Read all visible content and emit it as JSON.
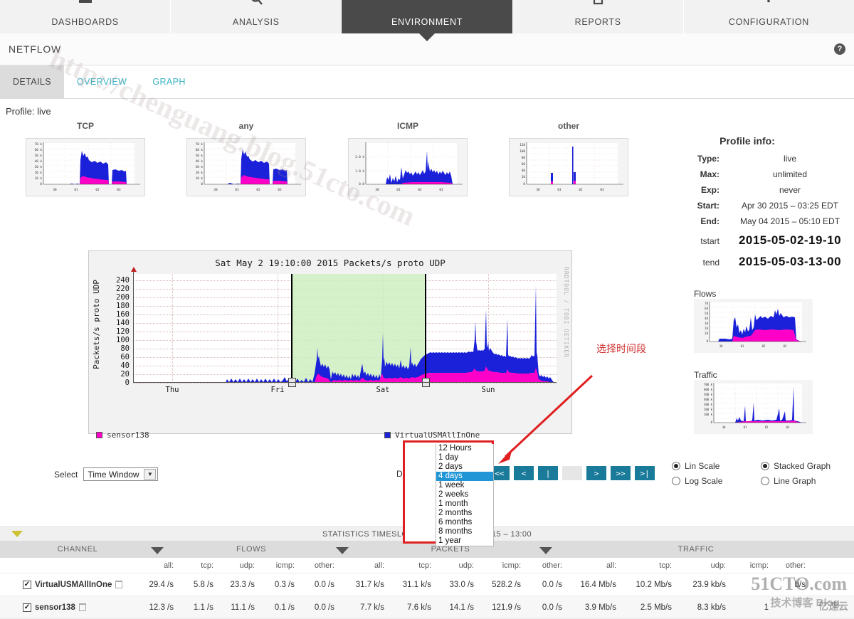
{
  "topnav": {
    "items": [
      {
        "label": "DASHBOARDS",
        "icon": "dashboard-grid-icon",
        "active": false
      },
      {
        "label": "ANALYSIS",
        "icon": "magnifier-icon",
        "active": false
      },
      {
        "label": "ENVIRONMENT",
        "icon": "network-icon",
        "active": true
      },
      {
        "label": "REPORTS",
        "icon": "document-icon",
        "active": false
      },
      {
        "label": "CONFIGURATION",
        "icon": "wrench-icon",
        "active": false
      }
    ]
  },
  "titlebar": {
    "title": "NETFLOW",
    "help_icon": "help-circle-icon"
  },
  "subtabs": [
    {
      "label": "DETAILS",
      "active": true
    },
    {
      "label": "OVERVIEW",
      "active": false
    },
    {
      "label": "GRAPH",
      "active": false
    }
  ],
  "profile_line": "Profile: live",
  "mini_graphs": [
    {
      "title": "TCP",
      "yticks": [
        "70 k",
        "60 k",
        "50 k",
        "40 k",
        "30 k",
        "20 k",
        "10 k",
        "0"
      ],
      "xticks": [
        "30",
        "01",
        "02",
        "03"
      ]
    },
    {
      "title": "any",
      "yticks": [
        "70 k",
        "60 k",
        "50 k",
        "40 k",
        "30 k",
        "20 k",
        "10 k",
        "0"
      ],
      "xticks": [
        "30",
        "01",
        "02",
        "03"
      ]
    },
    {
      "title": "ICMP",
      "yticks": [
        "2.0 k",
        "1.0 k",
        "0.0"
      ],
      "xticks": [
        "30",
        "01",
        "02",
        "03"
      ]
    },
    {
      "title": "other",
      "yticks": [
        "120",
        "100",
        "80",
        "60",
        "40",
        "20",
        "0"
      ],
      "xticks": [
        "30",
        "01",
        "02",
        "03"
      ]
    }
  ],
  "side_graphs": [
    {
      "title": "Flows",
      "yticks": [
        "70",
        "60",
        "50",
        "40",
        "30",
        "20",
        "10",
        "0"
      ],
      "xticks": [
        "30",
        "01",
        "02",
        "03"
      ]
    },
    {
      "title": "Traffic",
      "yticks": [
        "700 k",
        "600 k",
        "500 k",
        "400 k",
        "300 k",
        "200 k",
        "100 k",
        "0"
      ],
      "xticks": [
        "30",
        "01",
        "02",
        "03"
      ]
    }
  ],
  "chart_data": {
    "type": "area",
    "title": "Sat May  2 19:10:00 2015 Packets/s proto UDP",
    "ylabel": "Packets/s proto UDP",
    "xlabel": "",
    "credit": "RRDTOOL / TOBI OETIKER",
    "ylim": [
      0,
      250
    ],
    "yticks": [
      0,
      20,
      40,
      60,
      80,
      100,
      120,
      140,
      160,
      180,
      200,
      220,
      240
    ],
    "xticks": [
      "Thu",
      "Fri",
      "Sat",
      "Sun"
    ],
    "grid": true,
    "legend_position": "bottom",
    "series": [
      {
        "name": "sensor138",
        "color": "#ff00c8"
      },
      {
        "name": "VirtualUSMAllInOne",
        "color": "#1a21d8"
      }
    ],
    "selection": {
      "start_label": "Sat",
      "end_label": "Sun",
      "highlight_color": "#cdeec0"
    }
  },
  "profile_info": {
    "heading": "Profile info:",
    "rows": [
      {
        "key": "Type:",
        "value": "live"
      },
      {
        "key": "Max:",
        "value": "unlimited"
      },
      {
        "key": "Exp:",
        "value": "never"
      },
      {
        "key": "Start:",
        "value": "Apr 30 2015 – 03:25 EDT"
      },
      {
        "key": "End:",
        "value": "May 04 2015 – 05:10 EDT"
      }
    ],
    "tstart_key": "tstart",
    "tstart_value": "2015-05-02-19-10",
    "tend_key": "tend",
    "tend_value": "2015-05-03-13-00"
  },
  "controls": {
    "select_label": "Select",
    "select_value": "Time Window",
    "select_caret": "chevron-down-icon",
    "display_label": "Display:",
    "nav_buttons": [
      {
        "label": "<<",
        "name": "nav-first-back",
        "disabled": false
      },
      {
        "label": "<",
        "name": "nav-back",
        "disabled": false
      },
      {
        "label": "|",
        "name": "nav-mark",
        "disabled": false
      },
      {
        "label": "",
        "name": "nav-disabled",
        "disabled": true
      },
      {
        "label": ">",
        "name": "nav-forward",
        "disabled": false
      },
      {
        "label": ">>",
        "name": "nav-fast-forward",
        "disabled": false
      },
      {
        "label": ">|",
        "name": "nav-last",
        "disabled": false
      }
    ],
    "scale_options": [
      {
        "label": "Lin Scale",
        "selected": true
      },
      {
        "label": "Stacked Graph",
        "selected": true
      },
      {
        "label": "Log Scale",
        "selected": false
      },
      {
        "label": "Line Graph",
        "selected": false
      }
    ]
  },
  "dropdown": {
    "options": [
      "12 Hours",
      "1 day",
      "2 days",
      "4 days",
      "1 week",
      "2 weeks",
      "1 month",
      "2 months",
      "6 months",
      "8 months",
      "1 year"
    ],
    "selected": "4 days",
    "highlight_color": "#2196d6",
    "frame_color": "#e02020"
  },
  "annotation": {
    "text": "选择时间段",
    "color": "#d03030",
    "arrow": "red-arrow-icon"
  },
  "stats": {
    "collapse_icon": "triangle-down-icon",
    "timeslot": "STATISTICS TIMESLOT MAY 02 20        AY 03 2015 – 13:00",
    "group_headers": [
      "CHANNEL",
      "FLOWS",
      "PACKETS",
      "TRAFFIC"
    ],
    "sort_icon": "sort-down-icon",
    "sub_headers": [
      "all:",
      "tcp:",
      "udp:",
      "icmp:",
      "other:",
      "all:",
      "tcp:",
      "udp:",
      "icmp:",
      "other:",
      "all:",
      "tcp:",
      "udp:",
      "icmp:",
      "other:"
    ],
    "rows": [
      {
        "checked": true,
        "name": "VirtualUSMAllInOne",
        "delete_icon": "trash-icon",
        "values": [
          "29.4 /s",
          "5.8 /s",
          "23.3 /s",
          "0.3 /s",
          "0.0 /s",
          "31.7 k/s",
          "31.1 k/s",
          "33.0 /s",
          "528.2 /s",
          "0.0 /s",
          "16.4 Mb/s",
          "10.2 Mb/s",
          "23.9 kb/s",
          "",
          "b/s"
        ]
      },
      {
        "checked": true,
        "name": "sensor138",
        "delete_icon": "trash-icon",
        "values": [
          "12.3 /s",
          "1.1 /s",
          "11.1 /s",
          "0.1 /s",
          "0.0 /s",
          "7.7 k/s",
          "7.6 k/s",
          "14.1 /s",
          "121.9 /s",
          "0.0 /s",
          "3.9 Mb/s",
          "2.5 Mb/s",
          "8.3 kb/s",
          "1",
          ""
        ]
      }
    ]
  },
  "watermarks": {
    "url": "http://chenguang.blog.51cto.com",
    "brand": "51CTO.com",
    "brand_sub": "技术博客  Blog",
    "corner": "亿速云"
  }
}
